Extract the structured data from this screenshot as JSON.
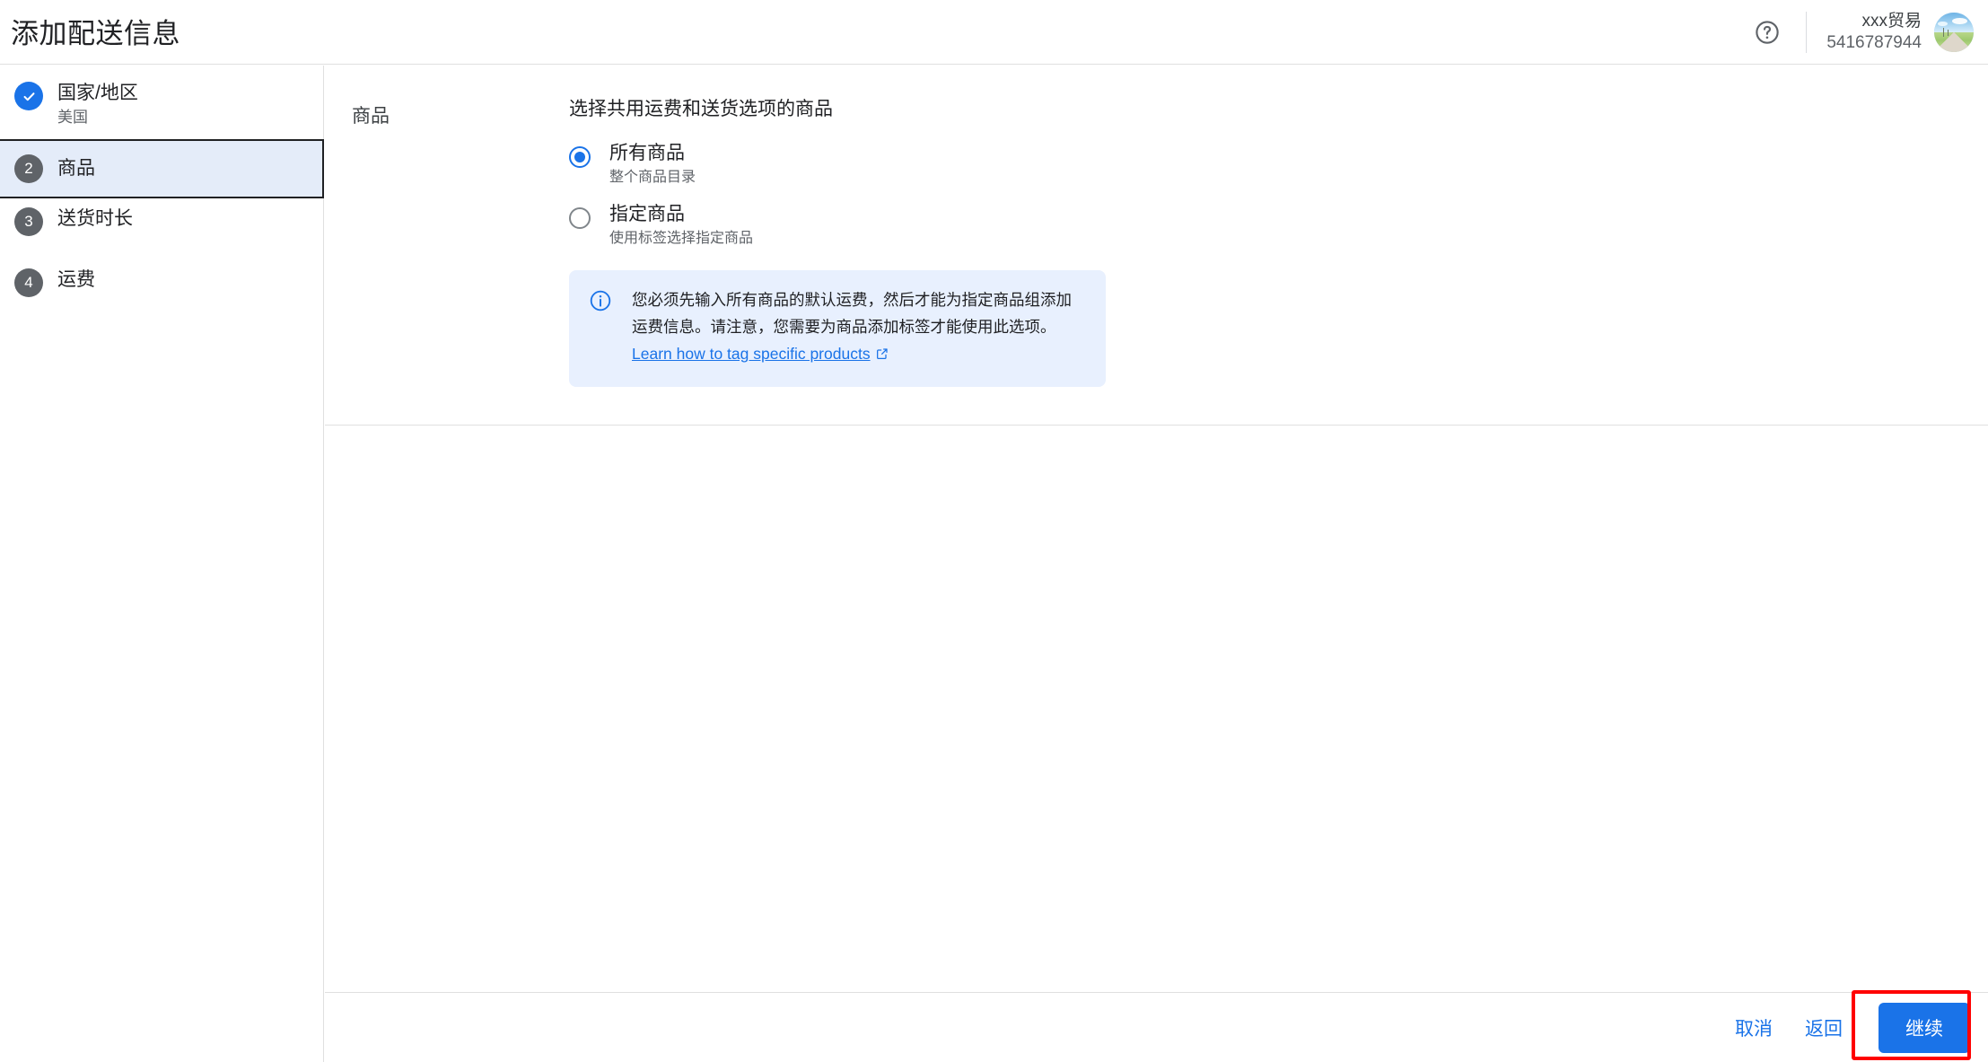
{
  "header": {
    "title": "添加配送信息",
    "help_icon": "help-circle-icon",
    "account_name": "xxx贸易",
    "account_id": "5416787944",
    "avatar_alt": "用户头像"
  },
  "sidebar": {
    "steps": [
      {
        "number": "1",
        "label": "国家/地区",
        "sub": "美国",
        "state": "done",
        "badge_glyph": "✓"
      },
      {
        "number": "2",
        "label": "商品",
        "sub": "",
        "state": "active",
        "badge_glyph": "2"
      },
      {
        "number": "3",
        "label": "送货时长",
        "sub": "",
        "state": "pending",
        "badge_glyph": "3"
      },
      {
        "number": "4",
        "label": "运费",
        "sub": "",
        "state": "pending",
        "badge_glyph": "4"
      }
    ]
  },
  "main": {
    "section_label": "商品",
    "heading": "选择共用运费和送货选项的商品",
    "options": [
      {
        "label": "所有商品",
        "sub": "整个商品目录",
        "selected": true
      },
      {
        "label": "指定商品",
        "sub": "使用标签选择指定商品",
        "selected": false
      }
    ],
    "info": {
      "icon": "info-circle-icon",
      "text": "您必须先输入所有商品的默认运费，然后才能为指定商品组添加运费信息。请注意，您需要为商品添加标签才能使用此选项。",
      "link_text": "Learn how to tag specific products",
      "link_icon": "external-link-icon"
    }
  },
  "footer": {
    "cancel_label": "取消",
    "back_label": "返回",
    "continue_label": "继续"
  },
  "colors": {
    "accent": "#1a73e8",
    "active_step_bg": "#e4ecf9",
    "info_bg": "#e8f0fe",
    "muted_text": "#5f6368",
    "highlight": "#ff0000"
  }
}
